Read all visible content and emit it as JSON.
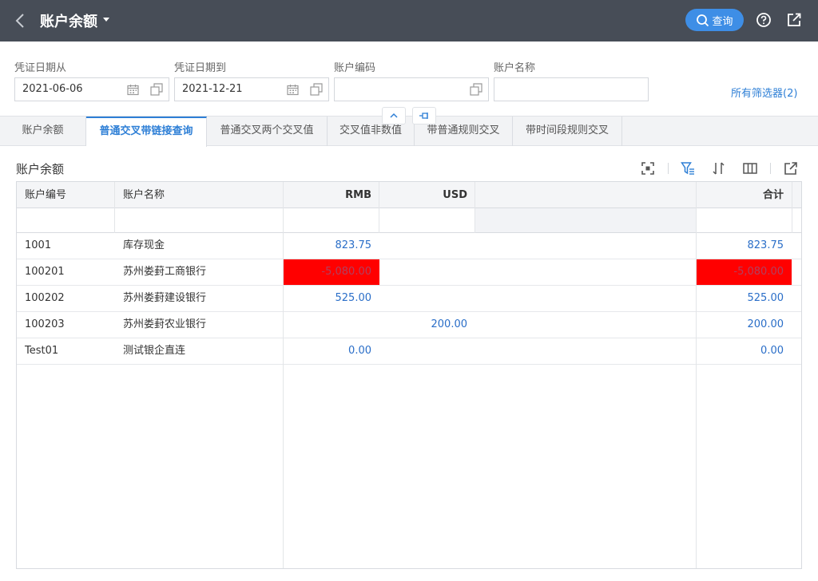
{
  "header": {
    "title": "账户余额",
    "query_label": "查询"
  },
  "filters": {
    "date_from": {
      "label": "凭证日期从",
      "value": "2021-06-06"
    },
    "date_to": {
      "label": "凭证日期到",
      "value": "2021-12-21"
    },
    "account_code": {
      "label": "账户编码",
      "value": ""
    },
    "account_name": {
      "label": "账户名称",
      "value": ""
    },
    "all_filters": "所有筛选器(2)"
  },
  "tabs": [
    {
      "label": "账户余额",
      "active": false
    },
    {
      "label": "普通交叉带链接查询",
      "active": true
    },
    {
      "label": "普通交叉两个交叉值",
      "active": false
    },
    {
      "label": "交叉值非数值",
      "active": false
    },
    {
      "label": "带普通规则交叉",
      "active": false
    },
    {
      "label": "带时间段规则交叉",
      "active": false
    }
  ],
  "section": {
    "title": "账户余额"
  },
  "table": {
    "columns": [
      "账户编号",
      "账户名称",
      "RMB",
      "USD",
      "",
      "合计"
    ],
    "rows": [
      {
        "code": "1001",
        "name": "库存现金",
        "rmb": "823.75",
        "usd": "",
        "total": "823.75"
      },
      {
        "code": "100201",
        "name": "苏州娄葑工商银行",
        "rmb": "-5,080.00",
        "usd": "",
        "total": "-5,080.00"
      },
      {
        "code": "100202",
        "name": "苏州娄葑建设银行",
        "rmb": "525.00",
        "usd": "",
        "total": "525.00"
      },
      {
        "code": "100203",
        "name": "苏州娄葑农业银行",
        "rmb": "",
        "usd": "200.00",
        "total": "200.00"
      },
      {
        "code": "Test01",
        "name": "测试银企直连",
        "rmb": "0.00",
        "usd": "",
        "total": "0.00"
      }
    ]
  },
  "colors": {
    "header_bg": "#474d57",
    "accent": "#2e7fd6",
    "query_button": "#3e8ee6",
    "negative_highlight": "#ff0000"
  }
}
